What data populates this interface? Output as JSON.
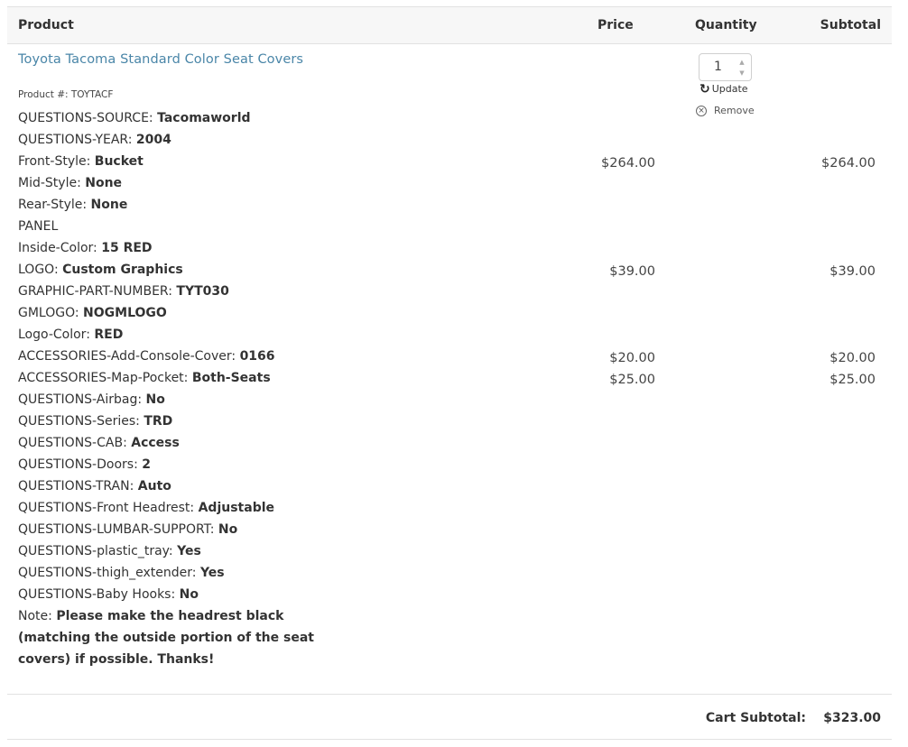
{
  "header": {
    "product": "Product",
    "price": "Price",
    "quantity": "Quantity",
    "subtotal": "Subtotal"
  },
  "item": {
    "title": "Toyota Tacoma Standard Color Seat Covers",
    "product_number": "Product #: TOYTACF",
    "quantity": "1",
    "update_label": "Update",
    "remove_label": "Remove",
    "options": [
      {
        "label": "QUESTIONS-SOURCE: ",
        "value": "Tacomaworld"
      },
      {
        "label": "QUESTIONS-YEAR: ",
        "value": "2004"
      },
      {
        "label": "Front-Style: ",
        "value": "Bucket"
      },
      {
        "label": "Mid-Style: ",
        "value": "None"
      },
      {
        "label": "Rear-Style: ",
        "value": "None"
      },
      {
        "label": "PANEL",
        "value": ""
      },
      {
        "label": "Inside-Color: ",
        "value": "15 RED"
      },
      {
        "label": "LOGO: ",
        "value": "Custom Graphics"
      },
      {
        "label": "GRAPHIC-PART-NUMBER: ",
        "value": "TYT030"
      },
      {
        "label": "GMLOGO: ",
        "value": "NOGMLOGO"
      },
      {
        "label": "Logo-Color: ",
        "value": "RED"
      },
      {
        "label": "ACCESSORIES-Add-Console-Cover: ",
        "value": "0166"
      },
      {
        "label": "ACCESSORIES-Map-Pocket: ",
        "value": "Both-Seats"
      },
      {
        "label": "QUESTIONS-Airbag: ",
        "value": "No"
      },
      {
        "label": "QUESTIONS-Series: ",
        "value": "TRD"
      },
      {
        "label": "QUESTIONS-CAB: ",
        "value": "Access"
      },
      {
        "label": "QUESTIONS-Doors: ",
        "value": "2"
      },
      {
        "label": "QUESTIONS-TRAN: ",
        "value": "Auto"
      },
      {
        "label": "QUESTIONS-Front Headrest: ",
        "value": "Adjustable"
      },
      {
        "label": "QUESTIONS-LUMBAR-SUPPORT: ",
        "value": "No"
      },
      {
        "label": "QUESTIONS-plastic_tray: ",
        "value": "Yes"
      },
      {
        "label": "QUESTIONS-thigh_extender: ",
        "value": "Yes"
      },
      {
        "label": "QUESTIONS-Baby Hooks: ",
        "value": "No"
      }
    ],
    "note_label": "Note: ",
    "note_value": "Please make the headrest black (matching the outside portion of the seat covers) if possible. Thanks!",
    "prices": [
      {
        "price": "$264.00",
        "subtotal": "$264.00"
      },
      {
        "price": "$39.00",
        "subtotal": "$39.00"
      },
      {
        "price": "$20.00",
        "subtotal": "$20.00"
      },
      {
        "price": "$25.00",
        "subtotal": "$25.00"
      }
    ]
  },
  "cart": {
    "subtotal_label": "Cart Subtotal:",
    "subtotal_value": "$323.00"
  },
  "colors": {
    "link": "#4a86a8",
    "header_bg": "#f7f7f7",
    "border": "#e2e2e2"
  }
}
